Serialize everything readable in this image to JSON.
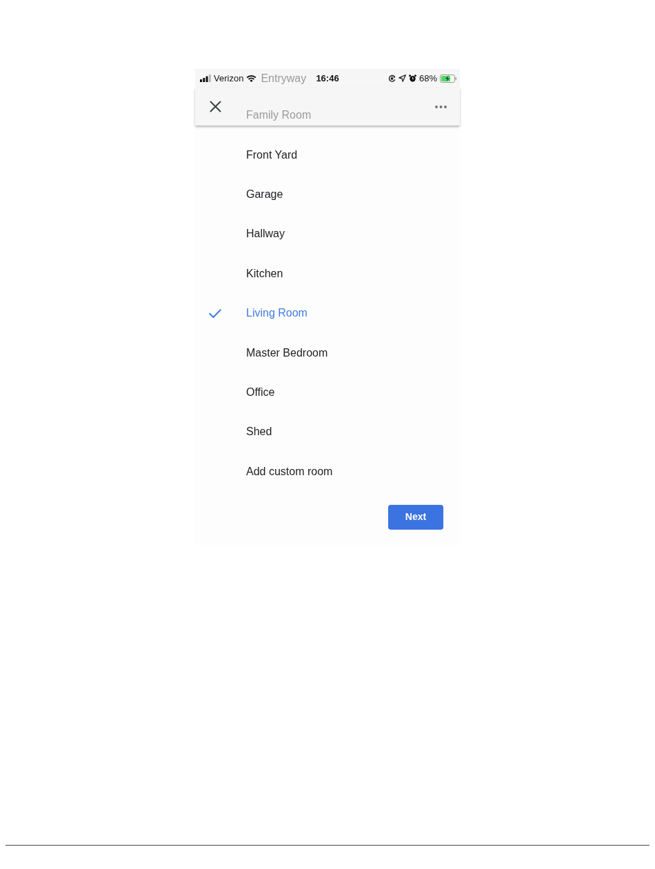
{
  "status_bar": {
    "carrier": "Verizon",
    "time": "16:46",
    "battery": "68%",
    "charging": true
  },
  "under_header": [
    "Entryway",
    "Family Room"
  ],
  "rooms": [
    {
      "name": "Front Yard",
      "selected": false
    },
    {
      "name": "Garage",
      "selected": false
    },
    {
      "name": "Hallway",
      "selected": false
    },
    {
      "name": "Kitchen",
      "selected": false
    },
    {
      "name": "Living Room",
      "selected": true
    },
    {
      "name": "Master Bedroom",
      "selected": false
    },
    {
      "name": "Office",
      "selected": false
    },
    {
      "name": "Shed",
      "selected": false
    }
  ],
  "add_custom_room": {
    "label": "Add custom room"
  },
  "next_button": {
    "label": "Next"
  }
}
